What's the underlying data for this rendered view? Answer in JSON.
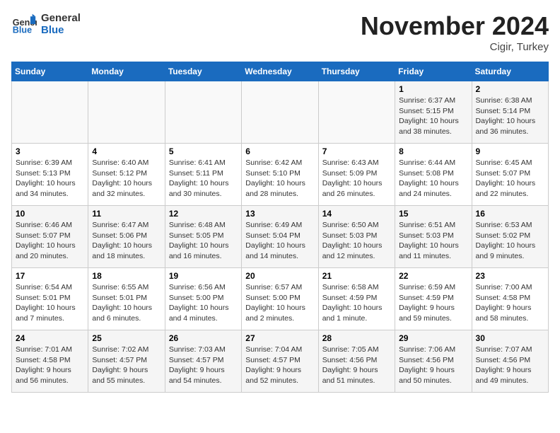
{
  "header": {
    "logo_general": "General",
    "logo_blue": "Blue",
    "month_title": "November 2024",
    "location": "Cigir, Turkey"
  },
  "days_of_week": [
    "Sunday",
    "Monday",
    "Tuesday",
    "Wednesday",
    "Thursday",
    "Friday",
    "Saturday"
  ],
  "weeks": [
    [
      {
        "day": "",
        "info": ""
      },
      {
        "day": "",
        "info": ""
      },
      {
        "day": "",
        "info": ""
      },
      {
        "day": "",
        "info": ""
      },
      {
        "day": "",
        "info": ""
      },
      {
        "day": "1",
        "info": "Sunrise: 6:37 AM\nSunset: 5:15 PM\nDaylight: 10 hours and 38 minutes."
      },
      {
        "day": "2",
        "info": "Sunrise: 6:38 AM\nSunset: 5:14 PM\nDaylight: 10 hours and 36 minutes."
      }
    ],
    [
      {
        "day": "3",
        "info": "Sunrise: 6:39 AM\nSunset: 5:13 PM\nDaylight: 10 hours and 34 minutes."
      },
      {
        "day": "4",
        "info": "Sunrise: 6:40 AM\nSunset: 5:12 PM\nDaylight: 10 hours and 32 minutes."
      },
      {
        "day": "5",
        "info": "Sunrise: 6:41 AM\nSunset: 5:11 PM\nDaylight: 10 hours and 30 minutes."
      },
      {
        "day": "6",
        "info": "Sunrise: 6:42 AM\nSunset: 5:10 PM\nDaylight: 10 hours and 28 minutes."
      },
      {
        "day": "7",
        "info": "Sunrise: 6:43 AM\nSunset: 5:09 PM\nDaylight: 10 hours and 26 minutes."
      },
      {
        "day": "8",
        "info": "Sunrise: 6:44 AM\nSunset: 5:08 PM\nDaylight: 10 hours and 24 minutes."
      },
      {
        "day": "9",
        "info": "Sunrise: 6:45 AM\nSunset: 5:07 PM\nDaylight: 10 hours and 22 minutes."
      }
    ],
    [
      {
        "day": "10",
        "info": "Sunrise: 6:46 AM\nSunset: 5:07 PM\nDaylight: 10 hours and 20 minutes."
      },
      {
        "day": "11",
        "info": "Sunrise: 6:47 AM\nSunset: 5:06 PM\nDaylight: 10 hours and 18 minutes."
      },
      {
        "day": "12",
        "info": "Sunrise: 6:48 AM\nSunset: 5:05 PM\nDaylight: 10 hours and 16 minutes."
      },
      {
        "day": "13",
        "info": "Sunrise: 6:49 AM\nSunset: 5:04 PM\nDaylight: 10 hours and 14 minutes."
      },
      {
        "day": "14",
        "info": "Sunrise: 6:50 AM\nSunset: 5:03 PM\nDaylight: 10 hours and 12 minutes."
      },
      {
        "day": "15",
        "info": "Sunrise: 6:51 AM\nSunset: 5:03 PM\nDaylight: 10 hours and 11 minutes."
      },
      {
        "day": "16",
        "info": "Sunrise: 6:53 AM\nSunset: 5:02 PM\nDaylight: 10 hours and 9 minutes."
      }
    ],
    [
      {
        "day": "17",
        "info": "Sunrise: 6:54 AM\nSunset: 5:01 PM\nDaylight: 10 hours and 7 minutes."
      },
      {
        "day": "18",
        "info": "Sunrise: 6:55 AM\nSunset: 5:01 PM\nDaylight: 10 hours and 6 minutes."
      },
      {
        "day": "19",
        "info": "Sunrise: 6:56 AM\nSunset: 5:00 PM\nDaylight: 10 hours and 4 minutes."
      },
      {
        "day": "20",
        "info": "Sunrise: 6:57 AM\nSunset: 5:00 PM\nDaylight: 10 hours and 2 minutes."
      },
      {
        "day": "21",
        "info": "Sunrise: 6:58 AM\nSunset: 4:59 PM\nDaylight: 10 hours and 1 minute."
      },
      {
        "day": "22",
        "info": "Sunrise: 6:59 AM\nSunset: 4:59 PM\nDaylight: 9 hours and 59 minutes."
      },
      {
        "day": "23",
        "info": "Sunrise: 7:00 AM\nSunset: 4:58 PM\nDaylight: 9 hours and 58 minutes."
      }
    ],
    [
      {
        "day": "24",
        "info": "Sunrise: 7:01 AM\nSunset: 4:58 PM\nDaylight: 9 hours and 56 minutes."
      },
      {
        "day": "25",
        "info": "Sunrise: 7:02 AM\nSunset: 4:57 PM\nDaylight: 9 hours and 55 minutes."
      },
      {
        "day": "26",
        "info": "Sunrise: 7:03 AM\nSunset: 4:57 PM\nDaylight: 9 hours and 54 minutes."
      },
      {
        "day": "27",
        "info": "Sunrise: 7:04 AM\nSunset: 4:57 PM\nDaylight: 9 hours and 52 minutes."
      },
      {
        "day": "28",
        "info": "Sunrise: 7:05 AM\nSunset: 4:56 PM\nDaylight: 9 hours and 51 minutes."
      },
      {
        "day": "29",
        "info": "Sunrise: 7:06 AM\nSunset: 4:56 PM\nDaylight: 9 hours and 50 minutes."
      },
      {
        "day": "30",
        "info": "Sunrise: 7:07 AM\nSunset: 4:56 PM\nDaylight: 9 hours and 49 minutes."
      }
    ]
  ]
}
